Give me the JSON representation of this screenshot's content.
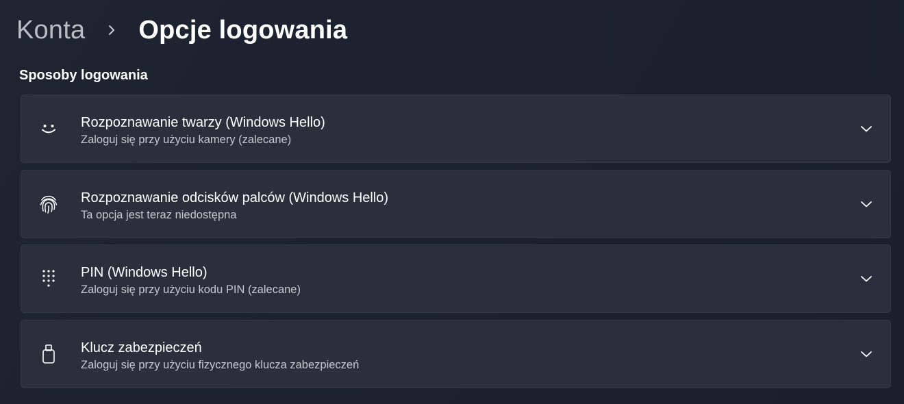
{
  "breadcrumb": {
    "parent": "Konta",
    "current": "Opcje logowania"
  },
  "section": {
    "title": "Sposoby logowania"
  },
  "options": [
    {
      "icon": "face-smile-icon",
      "title": "Rozpoznawanie twarzy (Windows Hello)",
      "subtitle": "Zaloguj się przy użyciu kamery (zalecane)"
    },
    {
      "icon": "fingerprint-icon",
      "title": "Rozpoznawanie odcisków palców (Windows Hello)",
      "subtitle": "Ta opcja jest teraz niedostępna"
    },
    {
      "icon": "pin-keypad-icon",
      "title": "PIN (Windows Hello)",
      "subtitle": "Zaloguj się przy użyciu kodu PIN (zalecane)"
    },
    {
      "icon": "security-key-icon",
      "title": "Klucz zabezpieczeń",
      "subtitle": "Zaloguj się przy użyciu fizycznego klucza zabezpieczeń"
    }
  ],
  "colors": {
    "background": "#1f2430",
    "card": "#2a2f3b",
    "text_primary": "#ffffff",
    "text_secondary": "#c5c8ce"
  }
}
